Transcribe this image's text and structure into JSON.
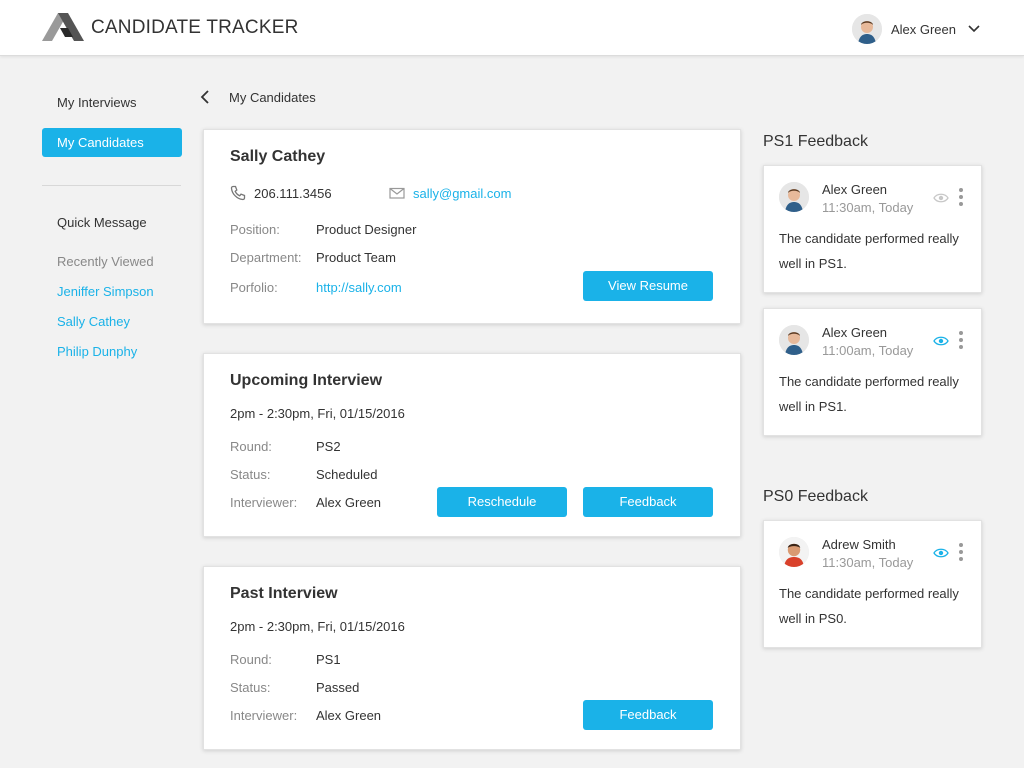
{
  "app": {
    "title": "CANDIDATE TRACKER"
  },
  "header": {
    "user_name": "Alex Green"
  },
  "sidebar": {
    "items": [
      {
        "label": "My Interviews"
      },
      {
        "label": "My Candidates"
      }
    ],
    "quick_message": "Quick Message",
    "recently_viewed_label": "Recently Viewed",
    "recently_viewed": [
      "Jeniffer Simpson",
      "Sally Cathey",
      "Philip Dunphy"
    ]
  },
  "breadcrumb": {
    "label": "My Candidates"
  },
  "candidate": {
    "name": "Sally Cathey",
    "phone": "206.111.3456",
    "email": "sally@gmail.com",
    "fields": [
      {
        "label": "Position:",
        "value": "Product Designer"
      },
      {
        "label": "Department:",
        "value": "Product Team"
      },
      {
        "label": "Porfolio:",
        "value": "http://sally.com"
      }
    ],
    "view_resume_label": "View Resume"
  },
  "upcoming": {
    "title": "Upcoming Interview",
    "datetime": "2pm - 2:30pm, Fri, 01/15/2016",
    "fields": [
      {
        "label": "Round:",
        "value": "PS2"
      },
      {
        "label": "Status:",
        "value": "Scheduled"
      },
      {
        "label": "Interviewer:",
        "value": "Alex Green"
      }
    ],
    "reschedule_label": "Reschedule",
    "feedback_label": "Feedback"
  },
  "past": {
    "title": "Past Interview",
    "datetime": "2pm - 2:30pm, Fri, 01/15/2016",
    "fields": [
      {
        "label": "Round:",
        "value": "PS1"
      },
      {
        "label": "Status:",
        "value": "Passed"
      },
      {
        "label": "Interviewer:",
        "value": "Alex Green"
      }
    ],
    "feedback_label": "Feedback"
  },
  "ps1_feedback": {
    "heading": "PS1 Feedback",
    "items": [
      {
        "name": "Alex Green",
        "time": "11:30am, Today",
        "text": "The candidate performed really well in PS1.",
        "eye_state": "inactive"
      },
      {
        "name": "Alex Green",
        "time": "11:00am, Today",
        "text": "The candidate performed really well in PS1.",
        "eye_state": "active"
      }
    ]
  },
  "ps0_feedback": {
    "heading": "PS0 Feedback",
    "items": [
      {
        "name": "Adrew Smith",
        "time": "11:30am, Today",
        "text": "The candidate performed really well in PS0.",
        "eye_state": "active"
      }
    ]
  },
  "colors": {
    "accent": "#1ab2e8",
    "muted": "#888888",
    "background": "#f2f2f2"
  },
  "icons": [
    "logo-icon",
    "chevron-down-icon",
    "back-icon",
    "phone-icon",
    "mail-icon",
    "eye-icon",
    "more-vertical-icon"
  ]
}
